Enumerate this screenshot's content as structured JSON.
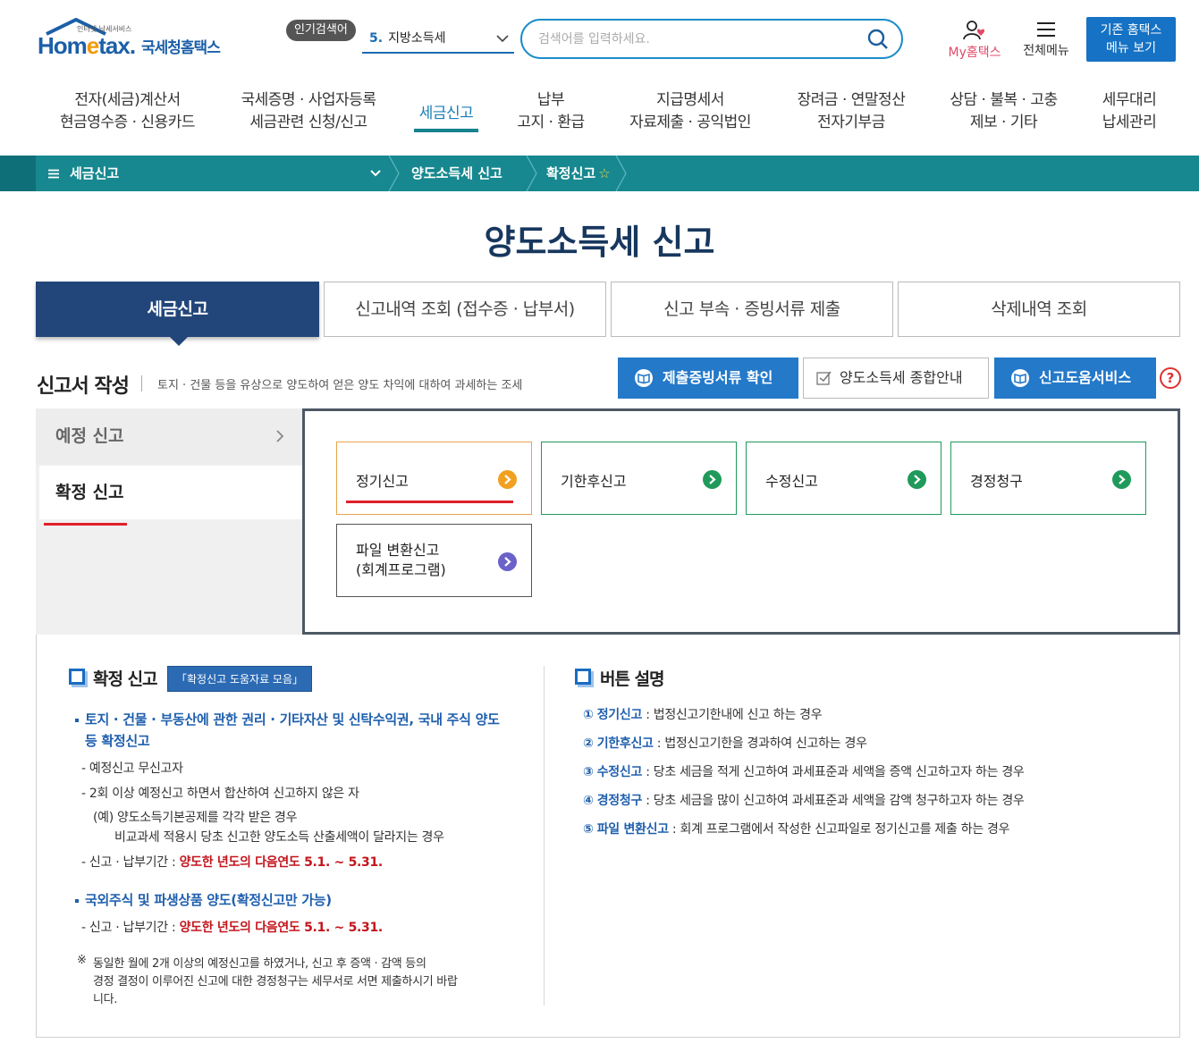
{
  "header": {
    "logo_tag": "인터넷 납세서비스",
    "logo_brand_pre": "Hom",
    "logo_brand_e": "e",
    "logo_brand_post": "tax.",
    "logo_kor": "국세청홈택스",
    "popular_badge": "인기검색어",
    "popular_num": "5.",
    "popular_term": "지방소득세",
    "search_placeholder": "검색어를 입력하세요.",
    "my_hometax": "My홈택스",
    "all_menu": "전체메뉴",
    "old_menu_line1": "기존 홈택스",
    "old_menu_line2": "메뉴 보기"
  },
  "gnb": [
    {
      "l1": "전자(세금)계산서",
      "l2": "현금영수증 · 신용카드"
    },
    {
      "l1": "국세증명 · 사업자등록",
      "l2": "세금관련 신청/신고"
    },
    {
      "l1": "세금신고",
      "l2": ""
    },
    {
      "l1": "납부",
      "l2": "고지 · 환급"
    },
    {
      "l1": "지급명세서",
      "l2": "자료제출 · 공익법인"
    },
    {
      "l1": "장려금 · 연말정산",
      "l2": "전자기부금"
    },
    {
      "l1": "상담 · 불복 · 고충",
      "l2": "제보 · 기타"
    },
    {
      "l1": "세무대리",
      "l2": "납세관리"
    }
  ],
  "breadcrumb": {
    "menu": "세금신고",
    "level2": "양도소득세 신고",
    "level3": "확정신고",
    "star": "☆"
  },
  "page_title": "양도소득세 신고",
  "tabs": [
    "세금신고",
    "신고내역 조회 (접수증 · 납부서)",
    "신고 부속 · 증빙서류 제출",
    "삭제내역 조회"
  ],
  "section": {
    "title": "신고서 작성",
    "desc": "토지 · 건물 등을 유상으로 양도하여 얻은 양도 차익에 대하여 과세하는 조세",
    "btn_evidence": "제출증빙서류 확인",
    "btn_guide": "양도소득세 종합안내",
    "btn_help": "신고도움서비스",
    "help_icon": "?"
  },
  "side_menu": {
    "item1": "예정 신고",
    "item2": "확정 신고"
  },
  "filing_buttons": {
    "regular": "정기신고",
    "late": "기한후신고",
    "amend": "수정신고",
    "claim": "경정청구",
    "file_l1": "파일 변환신고",
    "file_l2": "(회계프로그램)"
  },
  "info_left": {
    "title": "확정 신고",
    "badge": "「확정신고 도움자료 모음」",
    "b1_l1": "토지 · 건물 · 부동산에 관한 권리 · 기타자산 및 신탁수익권, 국내 주식 양도",
    "b1_l2": "등 확정신고",
    "s1": "- 예정신고 무신고자",
    "s2": "- 2회 이상 예정신고 하면서 합산하여 신고하지 않은 자",
    "ex1": "(예) 양도소득기본공제를 각각 받은 경우",
    "ex2": "비교과세 적용시 당초 신고한 양도소득 산출세액이 달라지는 경우",
    "period_label": "- 신고 · 납부기간 : ",
    "period_value": "양도한 년도의 다음연도 5.1. ~ 5.31.",
    "b2": "국외주식 및 파생상품 양도(확정신고만 가능)",
    "period2_label": "- 신고 · 납부기간 : ",
    "period2_value": "양도한 년도의 다음연도 5.1. ~ 5.31.",
    "note_mark": "※",
    "note_l1": "동일한 월에 2개 이상의 예정신고를 하였거나, 신고 후 증액 · 감액 등의",
    "note_l2": "경정 결정이 이루어진 신고에 대한 경정청구는 세무서로 서면 제출하시기 바랍",
    "note_l3": "니다."
  },
  "info_right": {
    "title": "버튼 설명",
    "items": [
      {
        "num": "①",
        "kw": "정기신고",
        "desc": " : 법정신고기한내에 신고 하는 경우"
      },
      {
        "num": "②",
        "kw": "기한후신고",
        "desc": " : 법정신고기한을 경과하여 신고하는 경우"
      },
      {
        "num": "③",
        "kw": "수정신고",
        "desc": " : 당초 세금을 적게 신고하여 과세표준과 세액을 증액 신고하고자 하는 경우"
      },
      {
        "num": "④",
        "kw": "경정청구",
        "desc": " : 당초 세금을 많이 신고하여 과세표준과 세액을 감액 청구하고자 하는 경우"
      },
      {
        "num": "⑤",
        "kw": "파일 변환신고",
        "desc": " : 회계 프로그램에서 작성한 신고파일로 정기신고를  제출 하는 경우"
      }
    ]
  }
}
